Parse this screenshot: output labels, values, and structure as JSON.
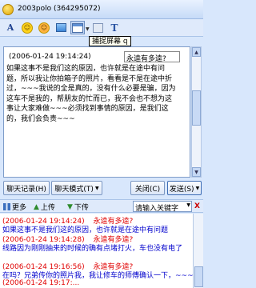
{
  "window": {
    "title": "2003polo (364295072)"
  },
  "toolbar": {
    "icons": [
      "font-icon",
      "emoticon-icon",
      "magic-emoticon-icon",
      "send-image-icon",
      "screen-capture-icon",
      "capture-options-icon",
      "text-formatting-icon"
    ]
  },
  "tooltip": {
    "text": "捕捉屏幕 q"
  },
  "editor": {
    "timestamp": "(2006-01-24 19:14:24)",
    "reply_field": "永逵有多逵?",
    "lines": [
      "如果这事不是我们这的原因，也许就是在途中有问",
      "题，所以我让你拍箱子的照片，看看是不是在途中折",
      "过，~~~我说的全是真的，没有什么必要是骗，因为",
      "这车不是我的，帮朋友的忙而已，我不会也不想为这",
      "事让大家难做~~~必须找到事情的原因，是我们这",
      "的，我们会负责~~~"
    ]
  },
  "buttons": {
    "chat_log": "聊天记录(H)",
    "chat_mode": "聊天模式(T)",
    "close": "关闭(C)",
    "send": "发送(S)"
  },
  "history_toolbar": {
    "more": "更多",
    "upload": "上传",
    "download": "下传",
    "keyword_placeholder": "请输入关键字",
    "close": "X"
  },
  "history": {
    "entries": [
      {
        "header": "(2006-01-24 19:14:24)",
        "sender": "永逵有多逵?",
        "body": "如果这事不是我们这的原因，也许就是在途中有问题"
      },
      {
        "header": "(2006-01-24 19:14:28)",
        "sender": "永逵有多逵?",
        "body": "线路因为刚刚抽来的时候的确有点堵打火，车也没有电了"
      },
      {
        "header": "(2006-01-24 19:16:56)",
        "sender": "永逵有多逵?",
        "body": "在吗？兄弟传你的照片我，我让修车的师傅确认一下，~~~"
      }
    ],
    "partial_header": "(2006-01-24 19:17:..."
  }
}
